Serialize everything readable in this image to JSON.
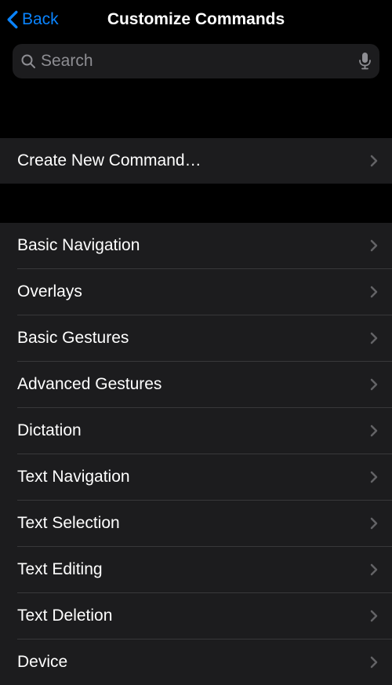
{
  "nav": {
    "back_label": "Back",
    "title": "Customize Commands"
  },
  "search": {
    "placeholder": "Search"
  },
  "section1": {
    "items": [
      {
        "label": "Create New Command…"
      }
    ]
  },
  "section2": {
    "items": [
      {
        "label": "Basic Navigation"
      },
      {
        "label": "Overlays"
      },
      {
        "label": "Basic Gestures"
      },
      {
        "label": "Advanced Gestures"
      },
      {
        "label": "Dictation"
      },
      {
        "label": "Text Navigation"
      },
      {
        "label": "Text Selection"
      },
      {
        "label": "Text Editing"
      },
      {
        "label": "Text Deletion"
      },
      {
        "label": "Device"
      }
    ]
  }
}
